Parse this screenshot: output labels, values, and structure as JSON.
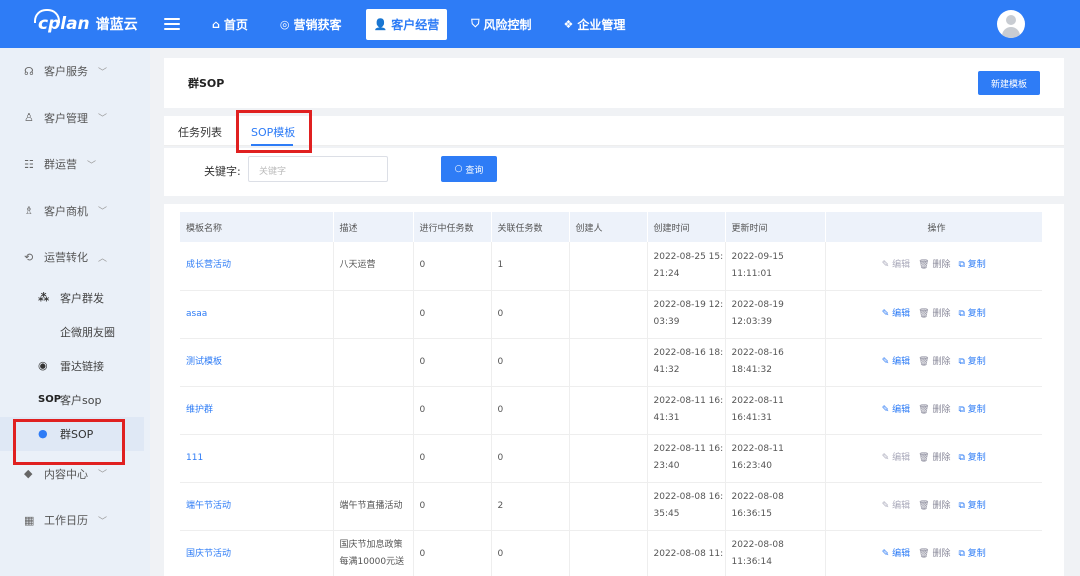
{
  "app": {
    "logo_mark": "cplan",
    "logo_name": "谱蓝云"
  },
  "nav": [
    {
      "label": "首页",
      "icon": "home-icon",
      "glyph": "⌂",
      "active": false
    },
    {
      "label": "营销获客",
      "icon": "marketing-icon",
      "glyph": "◎",
      "active": false
    },
    {
      "label": "客户经营",
      "icon": "user-icon",
      "glyph": "👤",
      "active": true
    },
    {
      "label": "风险控制",
      "icon": "shield-icon",
      "glyph": "⛉",
      "active": false
    },
    {
      "label": "企业管理",
      "icon": "enterprise-icon",
      "glyph": "❖",
      "active": false
    }
  ],
  "sidebar": {
    "groups": [
      {
        "label": "客户服务",
        "glyph": "☊"
      },
      {
        "label": "客户管理",
        "glyph": "♙"
      },
      {
        "label": "群运营",
        "glyph": "☷"
      },
      {
        "label": "客户商机",
        "glyph": "♗"
      },
      {
        "label": "运营转化",
        "glyph": "⟲"
      }
    ],
    "subs": [
      {
        "label": "客户群发",
        "glyph": "⁂"
      },
      {
        "label": "企微朋友圈",
        "glyph": ""
      },
      {
        "label": "雷达链接",
        "glyph": "◉"
      },
      {
        "label": "客户sop",
        "glyph": "SOP"
      },
      {
        "label": "群SOP",
        "glyph": "●"
      }
    ],
    "more": [
      {
        "label": "内容中心",
        "glyph": "◆"
      },
      {
        "label": "工作日历",
        "glyph": "▦"
      }
    ]
  },
  "header": {
    "title": "群SOP",
    "new_button": "新建模板"
  },
  "tabs": {
    "task_list": "任务列表",
    "sop_template": "SOP模板"
  },
  "search": {
    "label": "关键字:",
    "placeholder": "关键字",
    "query_button": "查询"
  },
  "table": {
    "columns": [
      "模板名称",
      "描述",
      "进行中任务数",
      "关联任务数",
      "创建人",
      "创建时间",
      "更新时间",
      "操作"
    ],
    "ops": {
      "edit": "编辑",
      "delete": "删除",
      "copy": "复制"
    },
    "rows": [
      {
        "name": "成长营活动",
        "desc": "八天运营",
        "running": "0",
        "related": "1",
        "creator": "",
        "created_a": "2022-08-25 15:",
        "created_b": "21:24",
        "updated": "2022-09-15 11:11:01",
        "editable": false
      },
      {
        "name": "asaa",
        "desc": "",
        "running": "0",
        "related": "0",
        "creator": "",
        "created_a": "2022-08-19 12:",
        "created_b": "03:39",
        "updated": "2022-08-19 12:03:39",
        "editable": true
      },
      {
        "name": "测试模板",
        "desc": "",
        "running": "0",
        "related": "0",
        "creator": "",
        "created_a": "2022-08-16 18:",
        "created_b": "41:32",
        "updated": "2022-08-16 18:41:32",
        "editable": true
      },
      {
        "name": "维护群",
        "desc": "",
        "running": "0",
        "related": "0",
        "creator": "",
        "created_a": "2022-08-11 16:",
        "created_b": "41:31",
        "updated": "2022-08-11 16:41:31",
        "editable": true
      },
      {
        "name": "111",
        "desc": "",
        "running": "0",
        "related": "0",
        "creator": "",
        "created_a": "2022-08-11 16:",
        "created_b": "23:40",
        "updated": "2022-08-11 16:23:40",
        "editable": false
      },
      {
        "name": "端午节活动",
        "desc": "端午节直播活动",
        "running": "0",
        "related": "2",
        "creator": "",
        "created_a": "2022-08-08 16:",
        "created_b": "35:45",
        "updated": "2022-08-08 16:36:15",
        "editable": false
      },
      {
        "name": "国庆节活动",
        "desc": "国庆节加息政策 每满10000元送",
        "running": "0",
        "related": "0",
        "creator": "",
        "created_a": "2022-08-08 11:",
        "created_b": "",
        "updated": "2022-08-08 11:36:14",
        "editable": true
      }
    ]
  }
}
